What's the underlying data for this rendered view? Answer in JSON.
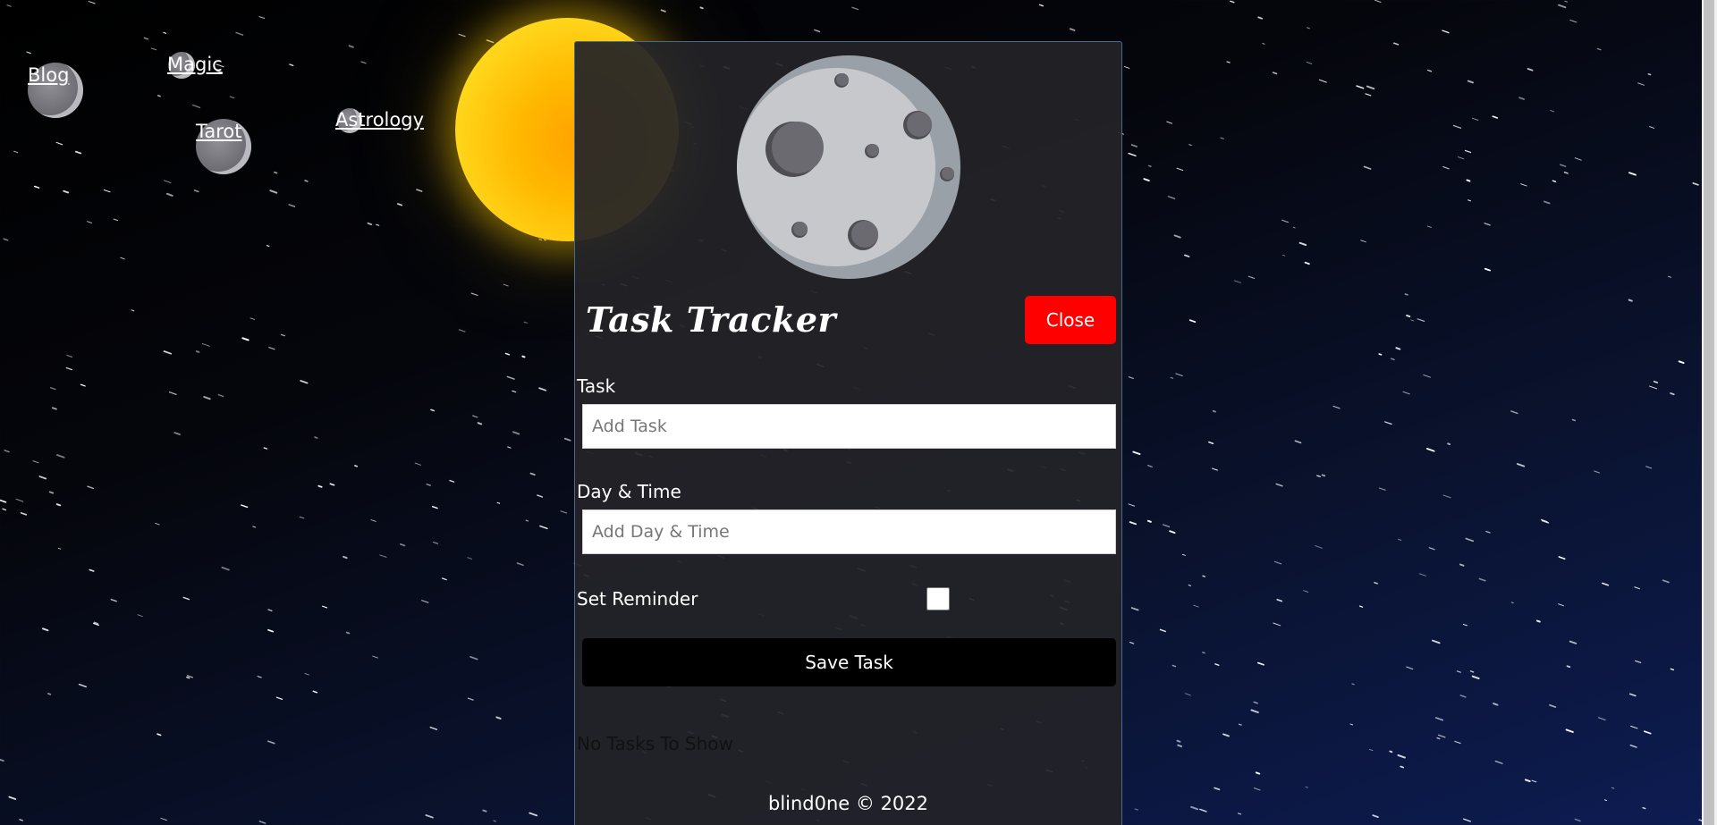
{
  "nav": {
    "items": [
      {
        "id": "blog",
        "label": "Blog"
      },
      {
        "id": "magic",
        "label": "Magic"
      },
      {
        "id": "tarot",
        "label": "Tarot"
      },
      {
        "id": "astrology",
        "label": "Astrology"
      }
    ]
  },
  "card": {
    "title": "Task Tracker",
    "close_label": "Close",
    "form": {
      "task_label": "Task",
      "task_placeholder": "Add Task",
      "task_value": "",
      "datetime_label": "Day & Time",
      "datetime_placeholder": "Add Day & Time",
      "datetime_value": "",
      "reminder_label": "Set Reminder",
      "reminder_checked": false,
      "save_label": "Save Task"
    },
    "empty_message": "No Tasks To Show",
    "footer": "blind0ne © 2022"
  },
  "colors": {
    "close_button": "#ff0000",
    "save_button": "#000000",
    "card_bg": "#242428",
    "sun": "#ffc400",
    "moon": "#c7c8cc"
  }
}
